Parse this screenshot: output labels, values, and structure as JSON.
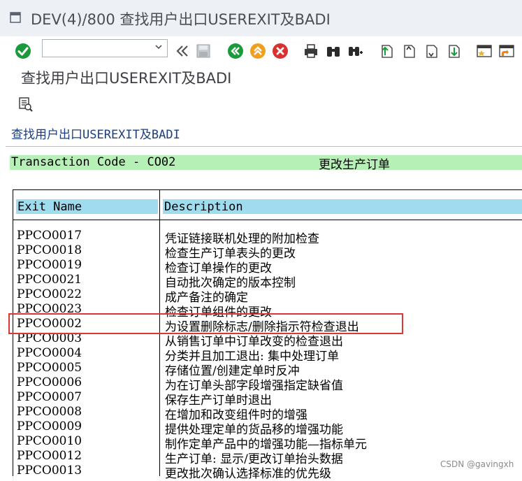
{
  "window": {
    "title": "DEV(4)/800 查找用户出口USEREXIT及BADI"
  },
  "toolbar": {
    "command_field_value": "",
    "buttons": [
      "enter-icon",
      "back-double-arrow-icon",
      "save-icon",
      "back-icon",
      "exit-icon",
      "cancel-icon",
      "print-icon",
      "find-icon",
      "find-next-icon",
      "first-page-icon",
      "previous-page-icon",
      "next-page-icon",
      "last-page-icon",
      "create-session-icon",
      "shortcut-icon"
    ]
  },
  "subtitle": "查找用户出口USEREXIT及BADI",
  "content": {
    "report_title": "查找用户出口USEREXIT及BADI",
    "tcode_label": "Transaction Code - CO02",
    "tcode_desc": "更改生产订单",
    "table": {
      "headers": [
        "Exit Name",
        "Description"
      ],
      "rows": [
        {
          "name": "PPCO0017",
          "desc": "凭证链接联机处理的附加检查"
        },
        {
          "name": "PPCO0018",
          "desc": "检查生产订单表头的更改"
        },
        {
          "name": "PPCO0019",
          "desc": "检查订单操作的更改"
        },
        {
          "name": "PPCO0021",
          "desc": "自动批次确定的版本控制"
        },
        {
          "name": "PPCO0022",
          "desc": "成产备注的确定"
        },
        {
          "name": "PPCO0023",
          "desc": "检查订单组件的更改"
        },
        {
          "name": "PPCO0002",
          "desc": "为设置删除标志/删除指示符检查退出"
        },
        {
          "name": "PPCO0003",
          "desc": "从销售订单中订单改变的检查退出"
        },
        {
          "name": "PPCO0004",
          "desc": "分类并且加工退出: 集中处理订单"
        },
        {
          "name": "PPCO0005",
          "desc": "存储位置/创建定单时反冲"
        },
        {
          "name": "PPCO0006",
          "desc": "为在订单头部字段增强指定缺省值"
        },
        {
          "name": "PPCO0007",
          "desc": "保存生产订单时退出"
        },
        {
          "name": "PPCO0008",
          "desc": "在增加和改变组件时的增强"
        },
        {
          "name": "PPCO0009",
          "desc": "提供处理定单的货品移的增强功能"
        },
        {
          "name": "PPCO0010",
          "desc": "制作定单产品中的增强功能—指标单元"
        },
        {
          "name": "PPCO0012",
          "desc": "生产订单: 显示/更改订单抬头数据"
        },
        {
          "name": "PPCO0013",
          "desc": "更改批次确认选择标准的优先级"
        }
      ]
    }
  },
  "watermark": "CSDN @gavingxh",
  "colors": {
    "titlebar_bg": "#edf0f4",
    "tcode_bar": "#b7f0b7",
    "header_cell": "#9fdcf0",
    "highlight_border": "#e03535",
    "enter_green": "#1a9b3a",
    "nav_orange": "#f0a020",
    "cancel_red": "#d93030"
  }
}
